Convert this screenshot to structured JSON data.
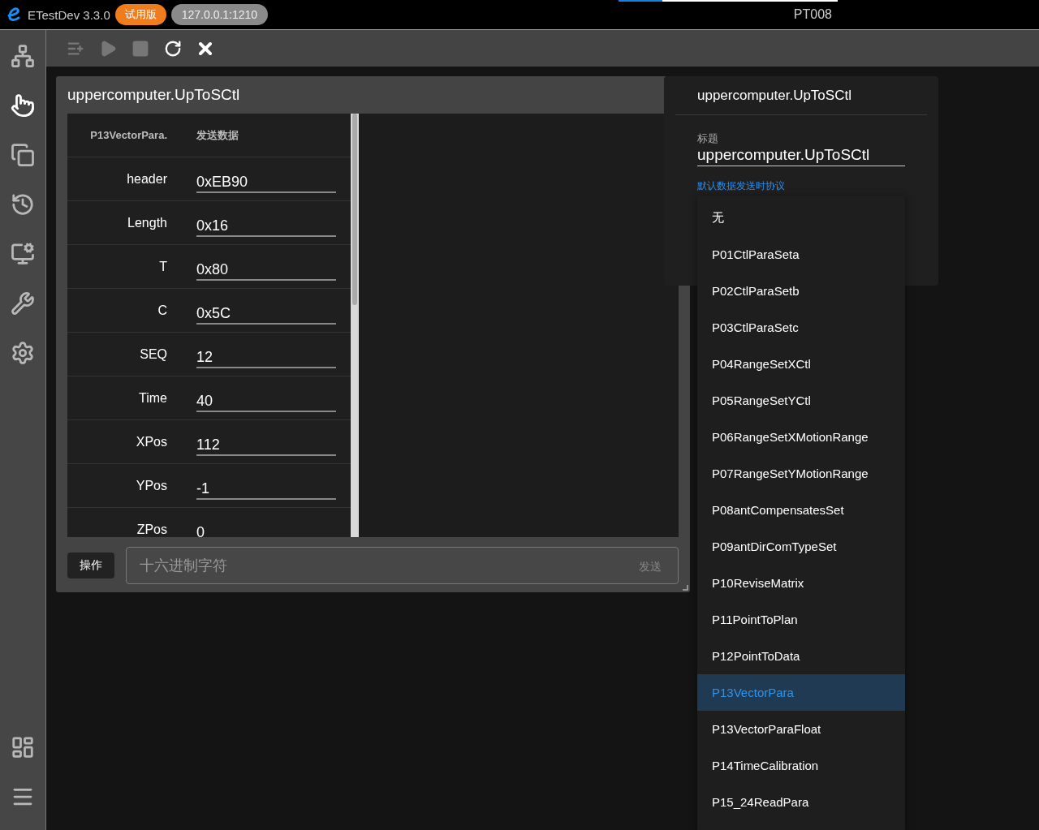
{
  "titlebar": {
    "app_name": "ETestDev 3.3.0",
    "trial_badge": "试用版",
    "address": "127.0.0.1:1210",
    "progress": {
      "level": 0.2
    },
    "device": "PT008"
  },
  "sidebar": {
    "items": [
      {
        "kind": "tree",
        "selected": false
      },
      {
        "kind": "touch",
        "selected": true
      },
      {
        "kind": "copy",
        "selected": false
      },
      {
        "kind": "history",
        "selected": false
      },
      {
        "kind": "monitor",
        "selected": false
      },
      {
        "kind": "tools",
        "selected": false
      },
      {
        "kind": "settings",
        "selected": false
      }
    ],
    "bottom_items": [
      {
        "kind": "dashboard",
        "selected": false
      },
      {
        "kind": "list",
        "selected": false
      }
    ]
  },
  "toolbar": [
    {
      "kind": "add",
      "disabled": true
    },
    {
      "kind": "play",
      "disabled": true
    },
    {
      "kind": "stop",
      "disabled": true
    },
    {
      "kind": "refresh",
      "disabled": false
    },
    {
      "kind": "close",
      "disabled": false
    }
  ],
  "card": {
    "title": "uppercomputer.UpToSCtl",
    "table": {
      "columns": [
        "P13VectorPara.",
        "发送数据"
      ],
      "rows": [
        {
          "name": "header",
          "value": "0xEB90"
        },
        {
          "name": "Length",
          "value": "0x16"
        },
        {
          "name": "T",
          "value": "0x80"
        },
        {
          "name": "C",
          "value": "0x5C"
        },
        {
          "name": "SEQ",
          "value": "12"
        },
        {
          "name": "Time",
          "value": "40"
        },
        {
          "name": "XPos",
          "value": "112"
        },
        {
          "name": "YPos",
          "value": "-1"
        },
        {
          "name": "ZPos",
          "value": "0"
        }
      ]
    },
    "action_button": "操作",
    "hex_input": {
      "placeholder": "十六进制字符"
    },
    "send_button": "发送"
  },
  "properties": {
    "title": "uppercomputer.UpToSCtl",
    "title_label": "标题",
    "title_value": "uppercomputer.UpToSCtl",
    "protocol_label": "默认数据发送时协议",
    "protocol_options": [
      {
        "label": "无",
        "selected": false
      },
      {
        "label": "P01CtlParaSeta",
        "selected": false
      },
      {
        "label": "P02CtlParaSetb",
        "selected": false
      },
      {
        "label": "P03CtlParaSetc",
        "selected": false
      },
      {
        "label": "P04RangeSetXCtl",
        "selected": false
      },
      {
        "label": "P05RangeSetYCtl",
        "selected": false
      },
      {
        "label": "P06RangeSetXMotionRange",
        "selected": false
      },
      {
        "label": "P07RangeSetYMotionRange",
        "selected": false
      },
      {
        "label": "P08antCompensatesSet",
        "selected": false
      },
      {
        "label": "P09antDirComTypeSet",
        "selected": false
      },
      {
        "label": "P10ReviseMatrix",
        "selected": false
      },
      {
        "label": "P11PointToPlan",
        "selected": false
      },
      {
        "label": "P12PointToData",
        "selected": false
      },
      {
        "label": "P13VectorPara",
        "selected": true
      },
      {
        "label": "P13VectorParaFloat",
        "selected": false
      },
      {
        "label": "P14TimeCalibration",
        "selected": false
      },
      {
        "label": "P15_24ReadPara",
        "selected": false
      }
    ]
  }
}
